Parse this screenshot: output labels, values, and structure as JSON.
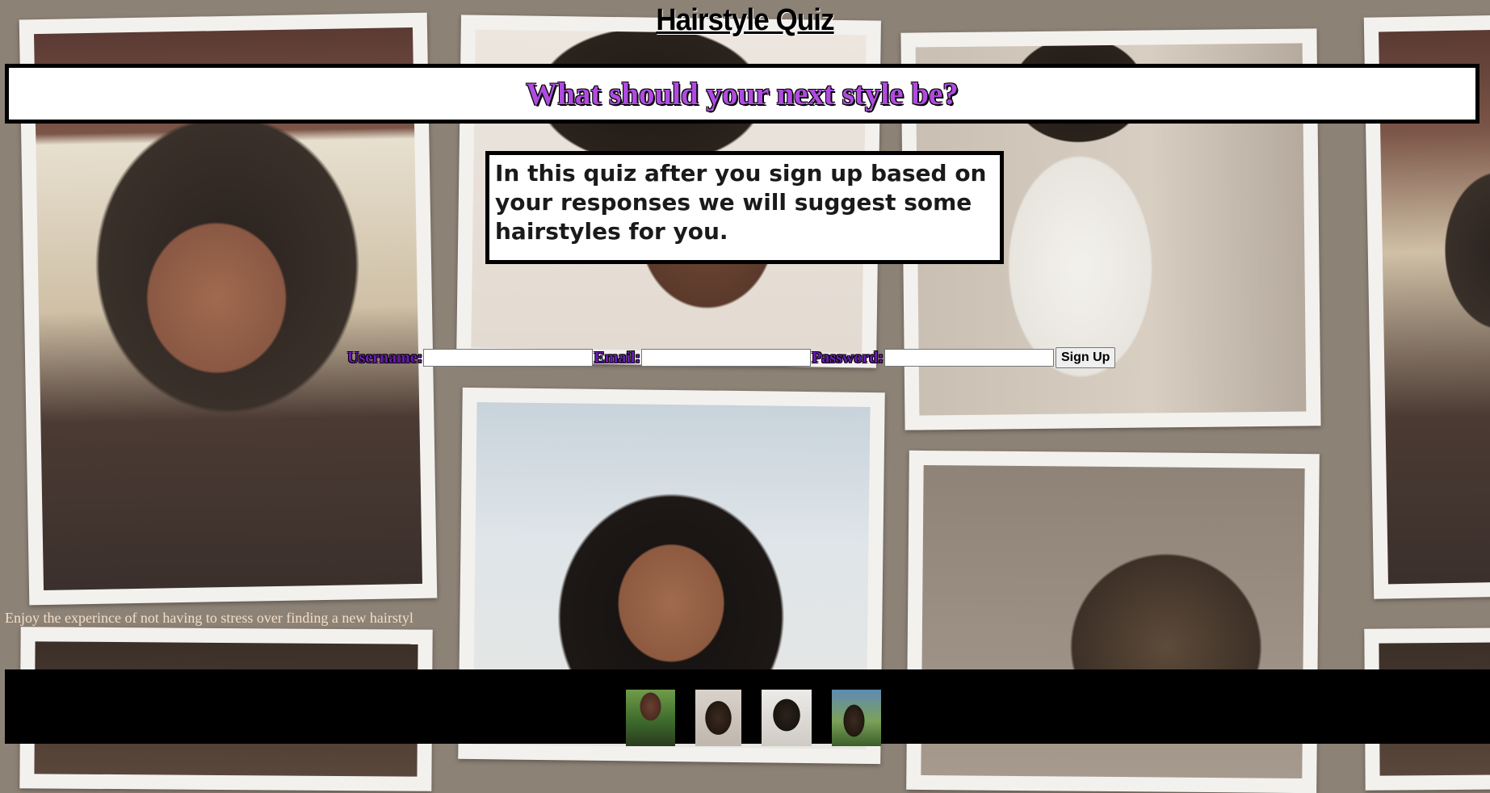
{
  "header": {
    "title": "Hairstyle Quiz",
    "subtitle": "What should your next style be?"
  },
  "intro": {
    "text": "In this quiz after you sign up based on your responses we will suggest some hairstyles for you."
  },
  "signup_form": {
    "username_label": "Username:",
    "username_value": "",
    "email_label": "Email:",
    "email_value": "",
    "password_label": "Password:",
    "password_value": "",
    "submit_label": "Sign Up"
  },
  "tagline": "Enjoy the experince of not having to stress over finding a new hairstyl",
  "footer": {
    "thumbnails": [
      {
        "icon": "hairstyle-photo-long-braids"
      },
      {
        "icon": "hairstyle-photo-heart-braids"
      },
      {
        "icon": "hairstyle-photo-sleek-bun"
      },
      {
        "icon": "hairstyle-photo-twists-outdoor"
      }
    ]
  },
  "colors": {
    "page_background": "#8d8276",
    "subtitle_purple": "#b04be0",
    "label_purple": "#6a1cb3",
    "tagline_text": "#f3dec7",
    "footer_background": "#000000"
  }
}
